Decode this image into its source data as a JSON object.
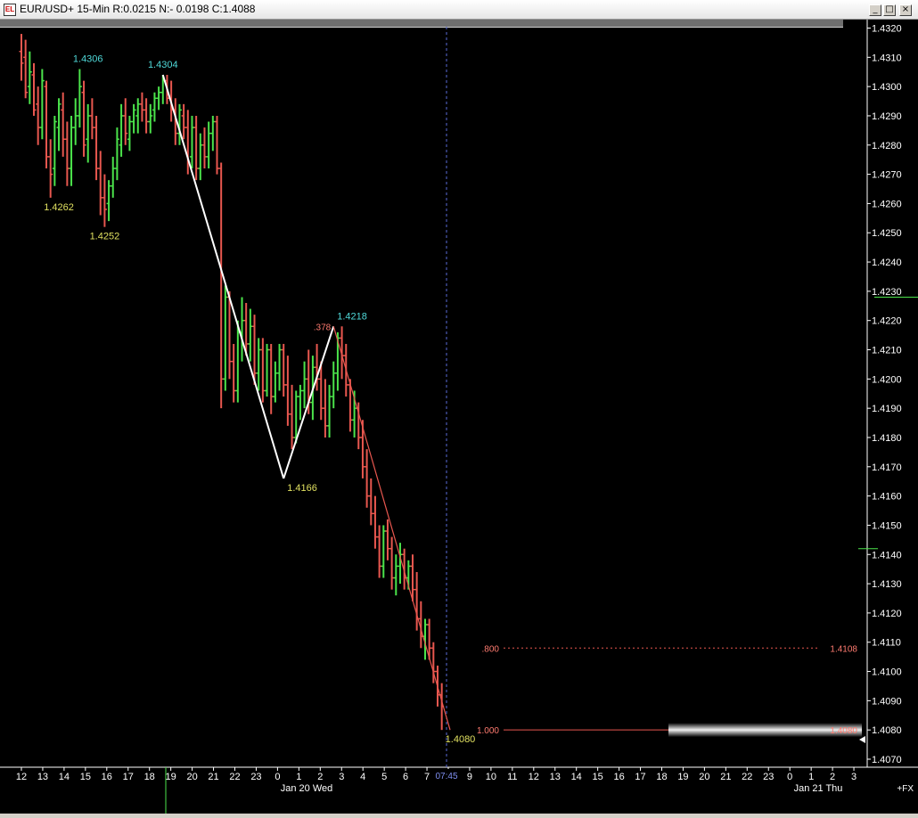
{
  "window": {
    "title": "EUR/USD+ 15-Min R:0.0215 N:- 0.0198 C:1.4088",
    "icon_label": "EL",
    "buttons": {
      "minimize": "_",
      "maximize": "□",
      "close": "×"
    }
  },
  "chart_data": {
    "type": "ohlc",
    "symbol": "EUR/USD+",
    "interval": "15-Min",
    "ylim": [
      1.4068,
      1.4322
    ],
    "y_ticks": [
      "1.4320",
      "1.4310",
      "1.4300",
      "1.4290",
      "1.4280",
      "1.4270",
      "1.4260",
      "1.4250",
      "1.4240",
      "1.4230",
      "1.4220",
      "1.4210",
      "1.4200",
      "1.4190",
      "1.4180",
      "1.4170",
      "1.4160",
      "1.4150",
      "1.4140",
      "1.4130",
      "1.4120",
      "1.4110",
      "1.4100",
      "1.4090",
      "1.4080",
      "1.4070"
    ],
    "x_ticks": [
      "12",
      "13",
      "14",
      "15",
      "16",
      "17",
      "18",
      "19",
      "20",
      "21",
      "22",
      "23",
      "0",
      "1",
      "2",
      "3",
      "4",
      "5",
      "6",
      "7",
      "8",
      "9",
      "10",
      "11",
      "12",
      "13",
      "14",
      "15",
      "16",
      "17",
      "18",
      "19",
      "20",
      "21",
      "22",
      "23",
      "0",
      "1",
      "2",
      "3"
    ],
    "date_labels": [
      "Jan 20 Wed",
      "Jan 21 Thu"
    ],
    "currency_tag": "+FX",
    "cursor_time": "07:45",
    "bars": [
      [
        1.4312,
        1.4318,
        1.4302,
        1.4308
      ],
      [
        1.431,
        1.4316,
        1.4296,
        1.4298
      ],
      [
        1.43,
        1.4312,
        1.4294,
        1.4305
      ],
      [
        1.4304,
        1.4308,
        1.429,
        1.4292
      ],
      [
        1.4294,
        1.43,
        1.428,
        1.4286
      ],
      [
        1.4286,
        1.4306,
        1.4282,
        1.4302
      ],
      [
        1.43,
        1.4302,
        1.4272,
        1.4276
      ],
      [
        1.4276,
        1.4282,
        1.4262,
        1.427
      ],
      [
        1.4272,
        1.429,
        1.4266,
        1.4288
      ],
      [
        1.4286,
        1.4296,
        1.4278,
        1.4294
      ],
      [
        1.4292,
        1.4298,
        1.4276,
        1.4282
      ],
      [
        1.4282,
        1.4288,
        1.4266,
        1.4272
      ],
      [
        1.4272,
        1.429,
        1.4266,
        1.4286
      ],
      [
        1.4286,
        1.4296,
        1.428,
        1.429
      ],
      [
        1.429,
        1.4306,
        1.4286,
        1.43
      ],
      [
        1.4298,
        1.4302,
        1.4276,
        1.428
      ],
      [
        1.4282,
        1.4294,
        1.4274,
        1.429
      ],
      [
        1.429,
        1.4296,
        1.4282,
        1.4286
      ],
      [
        1.4286,
        1.429,
        1.4268,
        1.4272
      ],
      [
        1.4272,
        1.4278,
        1.4256,
        1.4262
      ],
      [
        1.4262,
        1.427,
        1.4252,
        1.4258
      ],
      [
        1.426,
        1.4268,
        1.4254,
        1.4266
      ],
      [
        1.4266,
        1.4276,
        1.4262,
        1.4272
      ],
      [
        1.4272,
        1.4286,
        1.4268,
        1.4282
      ],
      [
        1.428,
        1.4294,
        1.4276,
        1.429
      ],
      [
        1.429,
        1.4296,
        1.428,
        1.4284
      ],
      [
        1.4282,
        1.429,
        1.4278,
        1.4288
      ],
      [
        1.4288,
        1.4294,
        1.4284,
        1.4292
      ],
      [
        1.429,
        1.4296,
        1.4284,
        1.4294
      ],
      [
        1.4294,
        1.4298,
        1.4288,
        1.4292
      ],
      [
        1.4292,
        1.4296,
        1.4284,
        1.4288
      ],
      [
        1.4288,
        1.4294,
        1.4284,
        1.429
      ],
      [
        1.4292,
        1.4298,
        1.4288,
        1.4296
      ],
      [
        1.4296,
        1.43,
        1.4292,
        1.4298
      ],
      [
        1.4298,
        1.4304,
        1.4294,
        1.4302
      ],
      [
        1.4302,
        1.4304,
        1.4294,
        1.4296
      ],
      [
        1.4296,
        1.4302,
        1.4288,
        1.4292
      ],
      [
        1.4292,
        1.4296,
        1.428,
        1.4284
      ],
      [
        1.4284,
        1.4294,
        1.428,
        1.4292
      ],
      [
        1.429,
        1.4294,
        1.4282,
        1.4286
      ],
      [
        1.4286,
        1.4292,
        1.427,
        1.4274
      ],
      [
        1.4276,
        1.429,
        1.4272,
        1.4286
      ],
      [
        1.4286,
        1.429,
        1.4268,
        1.4272
      ],
      [
        1.4272,
        1.4284,
        1.4268,
        1.428
      ],
      [
        1.428,
        1.4286,
        1.4272,
        1.4276
      ],
      [
        1.4276,
        1.4288,
        1.4272,
        1.4284
      ],
      [
        1.4284,
        1.429,
        1.4278,
        1.4288
      ],
      [
        1.4288,
        1.429,
        1.427,
        1.4272
      ],
      [
        1.4272,
        1.4274,
        1.419,
        1.42
      ],
      [
        1.42,
        1.4232,
        1.4196,
        1.4228
      ],
      [
        1.4228,
        1.423,
        1.42,
        1.4206
      ],
      [
        1.4206,
        1.4212,
        1.4192,
        1.4196
      ],
      [
        1.4196,
        1.422,
        1.4192,
        1.4216
      ],
      [
        1.4216,
        1.4228,
        1.4206,
        1.422
      ],
      [
        1.422,
        1.4226,
        1.4208,
        1.4212
      ],
      [
        1.4212,
        1.4224,
        1.4206,
        1.4218
      ],
      [
        1.4218,
        1.4222,
        1.4198,
        1.4202
      ],
      [
        1.4202,
        1.4214,
        1.4196,
        1.421
      ],
      [
        1.421,
        1.4214,
        1.4192,
        1.4196
      ],
      [
        1.4196,
        1.4212,
        1.4194,
        1.421
      ],
      [
        1.421,
        1.4212,
        1.4188,
        1.4194
      ],
      [
        1.4194,
        1.4206,
        1.4192,
        1.4202
      ],
      [
        1.4202,
        1.4212,
        1.4196,
        1.421
      ],
      [
        1.421,
        1.4212,
        1.4194,
        1.4198
      ],
      [
        1.4198,
        1.4208,
        1.4184,
        1.4188
      ],
      [
        1.4188,
        1.4198,
        1.4176,
        1.418
      ],
      [
        1.418,
        1.4196,
        1.4178,
        1.4194
      ],
      [
        1.4194,
        1.4198,
        1.4186,
        1.4196
      ],
      [
        1.4196,
        1.4206,
        1.419,
        1.42
      ],
      [
        1.42,
        1.421,
        1.4188,
        1.4192
      ],
      [
        1.4192,
        1.4208,
        1.4186,
        1.4204
      ],
      [
        1.4204,
        1.4212,
        1.4196,
        1.42
      ],
      [
        1.42,
        1.4206,
        1.4186,
        1.419
      ],
      [
        1.419,
        1.42,
        1.418,
        1.4184
      ],
      [
        1.4184,
        1.4198,
        1.418,
        1.4194
      ],
      [
        1.4194,
        1.4206,
        1.419,
        1.4202
      ],
      [
        1.4202,
        1.4216,
        1.4196,
        1.4214
      ],
      [
        1.4214,
        1.4218,
        1.42,
        1.4208
      ],
      [
        1.4208,
        1.4212,
        1.4194,
        1.4198
      ],
      [
        1.4198,
        1.42,
        1.4182,
        1.4186
      ],
      [
        1.4186,
        1.4196,
        1.418,
        1.419
      ],
      [
        1.419,
        1.4192,
        1.4176,
        1.418
      ],
      [
        1.418,
        1.4186,
        1.4166,
        1.417
      ],
      [
        1.417,
        1.4176,
        1.4156,
        1.416
      ],
      [
        1.416,
        1.4166,
        1.415,
        1.4154
      ],
      [
        1.4154,
        1.416,
        1.4142,
        1.4146
      ],
      [
        1.4146,
        1.415,
        1.4132,
        1.4136
      ],
      [
        1.4136,
        1.415,
        1.4132,
        1.4148
      ],
      [
        1.4148,
        1.4152,
        1.4138,
        1.4142
      ],
      [
        1.4142,
        1.4146,
        1.4128,
        1.4132
      ],
      [
        1.4132,
        1.414,
        1.4126,
        1.4136
      ],
      [
        1.4136,
        1.4144,
        1.413,
        1.414
      ],
      [
        1.414,
        1.4142,
        1.4128,
        1.4132
      ],
      [
        1.4132,
        1.4138,
        1.4128,
        1.4136
      ],
      [
        1.4136,
        1.414,
        1.4124,
        1.4128
      ],
      [
        1.4128,
        1.4134,
        1.4114,
        1.4118
      ],
      [
        1.4118,
        1.4124,
        1.4108,
        1.4112
      ],
      [
        1.4112,
        1.4118,
        1.4104,
        1.4116
      ],
      [
        1.4116,
        1.4118,
        1.4104,
        1.4108
      ],
      [
        1.4108,
        1.411,
        1.4096,
        1.41
      ],
      [
        1.41,
        1.4102,
        1.4088,
        1.4092
      ],
      [
        1.4092,
        1.4096,
        1.408,
        1.4088
      ]
    ],
    "colors": {
      "up": "#4be34b",
      "down": "#e8574f",
      "background": "#000000",
      "axis_text": "#ffffff"
    },
    "annotations": [
      {
        "label": "1.4306",
        "price": 1.4306,
        "bar": 16,
        "color": "#4fd8d8"
      },
      {
        "label": "1.4304",
        "price": 1.4304,
        "bar": 34,
        "color": "#4fd8d8"
      },
      {
        "label": "1.4262",
        "price": 1.4262,
        "bar": 9,
        "color": "#e0e060"
      },
      {
        "label": "1.4252",
        "price": 1.4252,
        "bar": 20,
        "color": "#e0e060"
      },
      {
        "label": "1.4218",
        "price": 1.4218,
        "bar": 75,
        "color": "#4fd8d8"
      },
      {
        "label": "1.4166",
        "price": 1.4166,
        "bar": 63,
        "color": "#e0e060"
      },
      {
        "label": "1.4080",
        "price": 1.408,
        "bar": 101,
        "color": "#e0e060"
      }
    ],
    "zigzag": [
      {
        "bar": 34,
        "price": 1.4304
      },
      {
        "bar": 63,
        "price": 1.4166
      },
      {
        "bar": 75,
        "price": 1.4218
      }
    ],
    "zigzag_ratio": {
      "label": ".378",
      "color": "#ff7b70"
    },
    "fib_levels": [
      {
        "ratio": ".800",
        "price_label": "1.4108",
        "price": 1.4108
      },
      {
        "ratio": "1.000",
        "price_label": "1.4080",
        "price": 1.408
      }
    ],
    "fib_color": "#e8574f",
    "markers": [
      {
        "label": "1.4228",
        "price": 1.4228,
        "color": "#4be34b"
      },
      {
        "label": "1.4142",
        "price": 1.4142,
        "color": "#4be34b"
      }
    ]
  }
}
